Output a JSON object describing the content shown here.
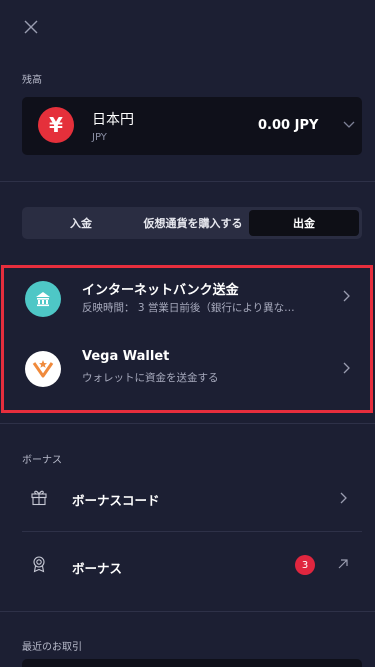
{
  "header": {
    "close_icon": "close-icon"
  },
  "balance": {
    "section_label": "残高",
    "currency_name": "日本円",
    "currency_code": "JPY",
    "amount": "0.00 JPY",
    "currency_symbol": "¥",
    "accent_color": "#e5303b"
  },
  "tabs": [
    {
      "label": "入金",
      "active": false
    },
    {
      "label": "仮想通貨を購入する",
      "active": false
    },
    {
      "label": "出金",
      "active": true
    }
  ],
  "methods": [
    {
      "title": "インターネットバンク送金",
      "subtitle": "反映時間： 3 営業日前後（銀行により異な…",
      "icon": "bank-icon"
    },
    {
      "title": "Vega Wallet",
      "subtitle": "ウォレットに資金を送金する",
      "icon": "vega-wallet-icon"
    }
  ],
  "bonus": {
    "section_label": "ボーナス",
    "items": [
      {
        "label": "ボーナスコード",
        "icon": "gift-icon"
      },
      {
        "label": "ボーナス",
        "icon": "award-icon",
        "badge": "3"
      }
    ]
  },
  "recent": {
    "section_label": "最近のお取引"
  },
  "highlight_color": "#e62e3d"
}
